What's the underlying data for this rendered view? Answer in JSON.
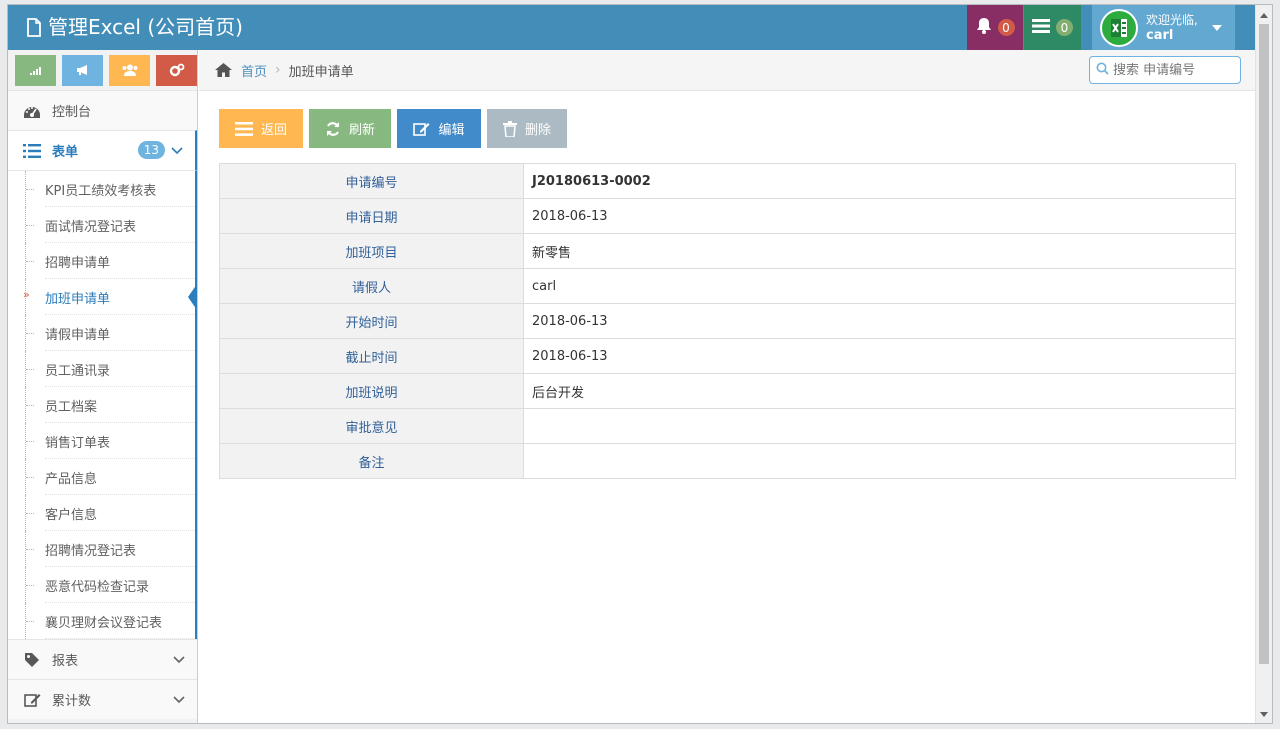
{
  "app": {
    "title": "管理Excel (公司首页)"
  },
  "header": {
    "notifications_count": "0",
    "tasks_count": "0",
    "welcome": "欢迎光临,",
    "username": "carl"
  },
  "sidebar": {
    "items": [
      {
        "label": "控制台",
        "icon": "dashboard-icon"
      },
      {
        "label": "表单",
        "icon": "list-icon",
        "badge": "13"
      },
      {
        "label": "报表",
        "icon": "tag-icon"
      },
      {
        "label": "累计数",
        "icon": "edit-icon"
      }
    ],
    "submenu": [
      "KPI员工绩效考核表",
      "面试情况登记表",
      "招聘申请单",
      "加班申请单",
      "请假申请单",
      "员工通讯录",
      "员工档案",
      "销售订单表",
      "产品信息",
      "客户信息",
      "招聘情况登记表",
      "恶意代码检查记录",
      "襄贝理财会议登记表"
    ]
  },
  "breadcrumb": {
    "home": "首页",
    "current": "加班申请单"
  },
  "search": {
    "placeholder": "搜索 申请编号"
  },
  "toolbar": {
    "back_label": "返回",
    "refresh_label": "刷新",
    "edit_label": "编辑",
    "delete_label": "删除"
  },
  "detail": {
    "rows": [
      {
        "label": "申请编号",
        "value": "J20180613-0002"
      },
      {
        "label": "申请日期",
        "value": "2018-06-13"
      },
      {
        "label": "加班项目",
        "value": "新零售"
      },
      {
        "label": "请假人",
        "value": "carl"
      },
      {
        "label": "开始时间",
        "value": "2018-06-13"
      },
      {
        "label": "截止时间",
        "value": "2018-06-13"
      },
      {
        "label": "加班说明",
        "value": "后台开发"
      },
      {
        "label": "审批意见",
        "value": ""
      },
      {
        "label": "备注",
        "value": ""
      }
    ]
  },
  "colors": {
    "navbar": "#438eb9",
    "accent": "#2b7dbc",
    "bell": "#892e65",
    "tasks": "#2e8965",
    "user": "#62a8d1",
    "btn_back": "#ffb752",
    "btn_refresh": "#87b87f",
    "btn_edit": "#428bca",
    "btn_delete": "#abbac3"
  }
}
